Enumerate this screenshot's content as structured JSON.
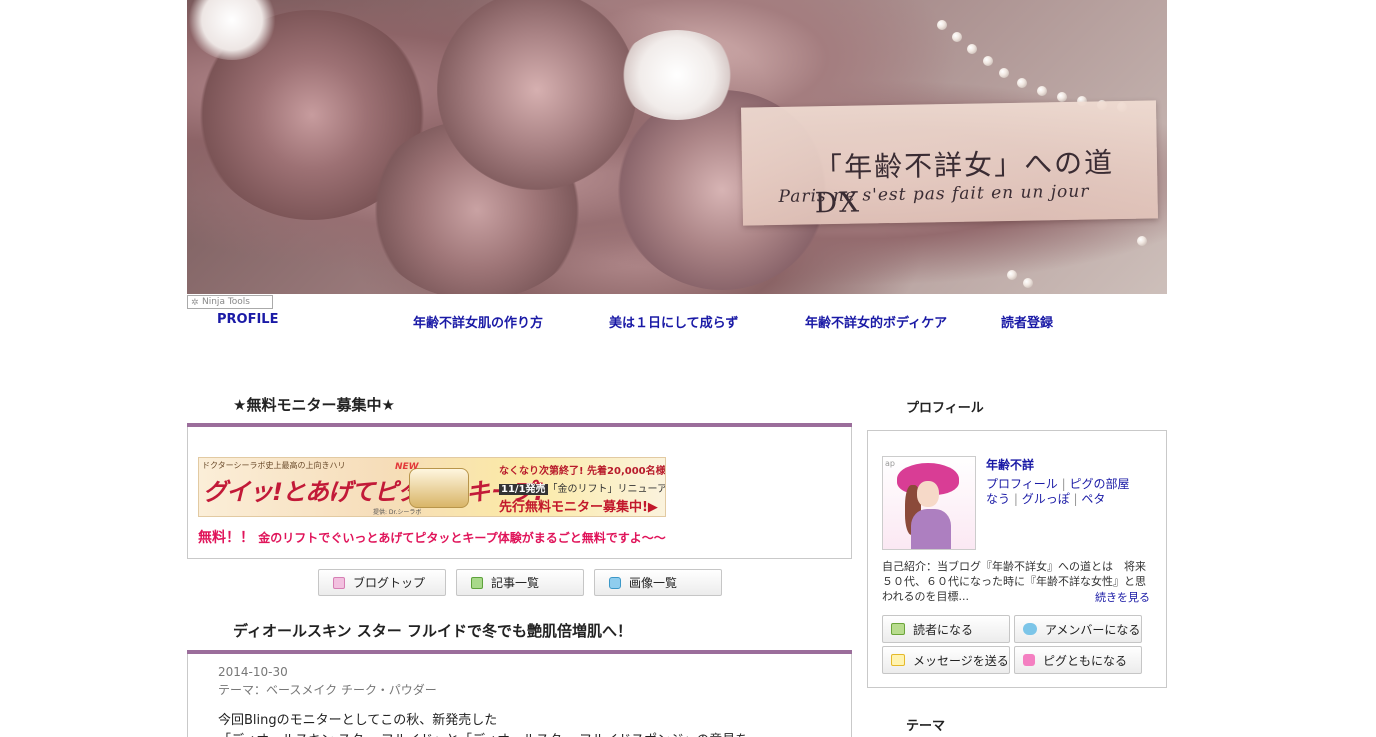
{
  "header": {
    "blog_title": "「年齢不詳女」への道DX",
    "blog_subtitle": "Paris ne s'est pas fait en un jour",
    "ninja_tools": "Ninja Tools"
  },
  "nav": {
    "items": [
      {
        "label": "PROFILE"
      },
      {
        "label": "年齢不詳女肌の作り方"
      },
      {
        "label": "美は１日にして成らず"
      },
      {
        "label": "年齢不詳女的ボディケア"
      },
      {
        "label": "読者登録"
      }
    ]
  },
  "monitor": {
    "heading": "★無料モニター募集中★",
    "banner": {
      "top_text": "ドクターシーラボ史上最高の上向きハリ",
      "main_text": "グイッ!とあげてピタッとキープ!",
      "new_badge": "NEW",
      "right_line1": "なくなり次第終了! 先着20,000名様",
      "right_line2_date": "11/1発売",
      "right_line2_text": "「金のリフト」リニューアル記念!",
      "right_line3": "先行無料モニター募集中!▶",
      "small_text": "提供: Dr.シーラボ"
    },
    "promo_big": "無料！！",
    "promo_small": "金のリフトでぐいっとあげてピタッとキープ体験がまるごと無料ですよ〜〜"
  },
  "blog_buttons": {
    "top": "ブログトップ",
    "articles": "記事一覧",
    "images": "画像一覧"
  },
  "article": {
    "title": "ディオールスキン スター フルイドで冬でも艶肌倍増肌へ！",
    "date": "2014-10-30",
    "theme": "テーマ：ベースメイク チーク・パウダー",
    "body_line1": "今回Blingのモニターとしてこの秋、新発売した",
    "body_line2": "「ディオールスキン スター フルイド」と「ディオールスター フルイドスポンジ」の意見を"
  },
  "sidebar": {
    "profile_heading": "プロフィール",
    "ameba_mark": "ap",
    "name": "年齢不詳",
    "links1": [
      "プロフィール",
      "ピグの部屋"
    ],
    "links2": [
      "なう",
      "グルっぽ",
      "ペタ"
    ],
    "intro": "自己紹介：当ブログ『年齢不詳女』への道とは　将来５０代、６０代になった時に『年齢不詳な女性』と思われるのを目標...",
    "more": "続きを見る",
    "buttons": {
      "reader": "読者になる",
      "amember": "アメンバーになる",
      "message": "メッセージを送る",
      "pig": "ピグともになる"
    },
    "theme_heading": "テーマ"
  },
  "colors": {
    "nav_link": "#1a1aa6",
    "accent_bar": "#9b6d9b",
    "promo": "#e0145a"
  }
}
